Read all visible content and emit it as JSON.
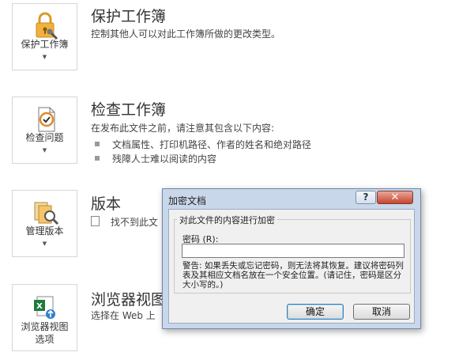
{
  "protect": {
    "tile_label": "保护工作簿",
    "tile_icon": "lock-key-icon",
    "title": "保护工作簿",
    "description": "控制其他人可以对此工作簿所做的更改类型。"
  },
  "inspect": {
    "tile_label": "检查问题",
    "tile_icon": "inspect-document-icon",
    "title": "检查工作簿",
    "description": "在发布此文件之前，请注意其包含以下内容:",
    "bullets": [
      "文档属性、打印机路径、作者的姓名和绝对路径",
      "残障人士难以阅读的内容"
    ]
  },
  "versions": {
    "tile_label": "管理版本",
    "tile_icon": "manage-versions-icon",
    "title": "版本",
    "description": "找不到此文"
  },
  "browser_view": {
    "tile_label_line1": "浏览器视图",
    "tile_label_line2": "选项",
    "tile_icon": "excel-browser-icon",
    "title": "浏览器视图",
    "description": "选择在 Web 上"
  },
  "dialog": {
    "title": "加密文档",
    "help_label": "?",
    "close_label": "✕",
    "group_label": "对此文件的内容进行加密",
    "password_label": "密码 (R):",
    "password_value": "",
    "warning": "警告: 如果丢失或忘记密码，则无法将其恢复。建议将密码列表及其相应文档名放在一个安全位置。(请记住，密码是区分大小写的。)",
    "ok_label": "确定",
    "cancel_label": "取消"
  },
  "colors": {
    "accent_orange": "#e8a33c",
    "dialog_frame": "#c9d7ea",
    "close_button": "#c8452e"
  }
}
